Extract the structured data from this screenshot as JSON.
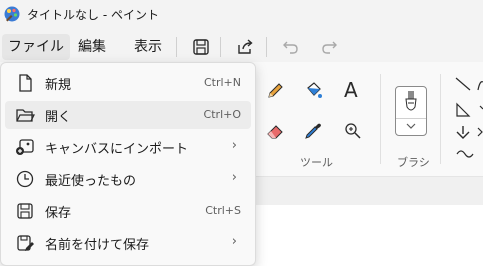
{
  "window": {
    "title": "タイトルなし - ペイント"
  },
  "menubar": {
    "file": "ファイル",
    "edit": "編集",
    "view": "表示"
  },
  "ribbon": {
    "tools_label": "ツール",
    "brush_label": "ブラシ",
    "text_tool_glyph": "A"
  },
  "file_menu": {
    "items": [
      {
        "label": "新規",
        "shortcut": "Ctrl+N",
        "submenu": ""
      },
      {
        "label": "開く",
        "shortcut": "Ctrl+O",
        "submenu": ""
      },
      {
        "label": "キャンバスにインポート",
        "shortcut": "",
        "submenu": "›"
      },
      {
        "label": "最近使ったもの",
        "shortcut": "",
        "submenu": "›"
      },
      {
        "label": "保存",
        "shortcut": "Ctrl+S",
        "submenu": ""
      },
      {
        "label": "名前を付けて保存",
        "shortcut": "",
        "submenu": "›"
      }
    ]
  },
  "colors": {
    "accent": "#0067c0",
    "pencil": "#e8a33d",
    "eraser": "#e86a6a",
    "picker": "#2f7fd6"
  }
}
